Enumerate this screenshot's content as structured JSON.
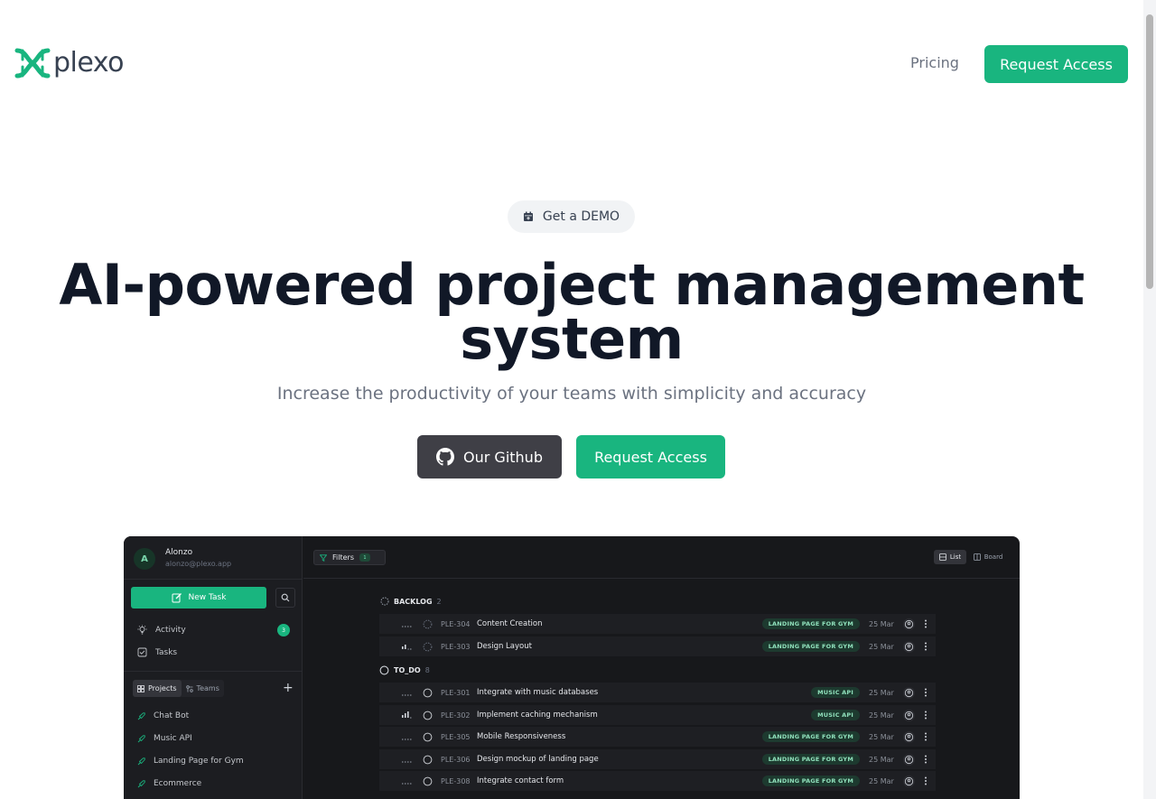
{
  "brand": {
    "name": "plexo",
    "accent": "#19b57f"
  },
  "nav": {
    "pricing": "Pricing",
    "request_access": "Request Access"
  },
  "hero": {
    "demo_pill": "Get a DEMO",
    "title": "AI-powered project management system",
    "subtitle": "Increase the productivity of your teams with simplicity and accuracy",
    "github_button": "Our Github",
    "access_button": "Request Access"
  },
  "app": {
    "user": {
      "initial": "A",
      "name": "Alonzo",
      "email": "alonzo@plexo.app"
    },
    "new_task": "New Task",
    "menu": [
      {
        "label": "Activity",
        "icon": "bulb-icon",
        "badge": "3"
      },
      {
        "label": "Tasks",
        "icon": "checkbox-icon"
      }
    ],
    "tabs": [
      {
        "label": "Projects",
        "icon": "grid-icon"
      },
      {
        "label": "Teams",
        "icon": "team-icon"
      }
    ],
    "projects": [
      "Chat Bot",
      "Music API",
      "Landing Page for Gym",
      "Ecommerce"
    ],
    "toolbar": {
      "filters": "Filters",
      "filter_count": "1",
      "list": "List",
      "board": "Board"
    },
    "groups": [
      {
        "name": "BACKLOG",
        "count": "2"
      },
      {
        "name": "TO_DO",
        "count": "8"
      }
    ],
    "tasks": [
      {
        "id": "PLE-304",
        "title": "Content Creation",
        "label": "LANDING PAGE FOR GYM",
        "date": "25 Mar",
        "priority": "none"
      },
      {
        "id": "PLE-303",
        "title": "Design Layout",
        "label": "LANDING PAGE FOR GYM",
        "date": "25 Mar",
        "priority": "medium"
      },
      {
        "id": "PLE-301",
        "title": "Integrate with music databases",
        "label": "MUSIC API",
        "date": "25 Mar",
        "priority": "none"
      },
      {
        "id": "PLE-302",
        "title": "Implement caching mechanism",
        "label": "MUSIC API",
        "date": "25 Mar",
        "priority": "high"
      },
      {
        "id": "PLE-305",
        "title": "Mobile Responsiveness",
        "label": "LANDING PAGE FOR GYM",
        "date": "25 Mar",
        "priority": "none"
      },
      {
        "id": "PLE-306",
        "title": "Design mockup of landing page",
        "label": "LANDING PAGE FOR GYM",
        "date": "25 Mar",
        "priority": "none"
      },
      {
        "id": "PLE-308",
        "title": "Integrate contact form",
        "label": "LANDING PAGE FOR GYM",
        "date": "25 Mar",
        "priority": "none"
      }
    ]
  }
}
